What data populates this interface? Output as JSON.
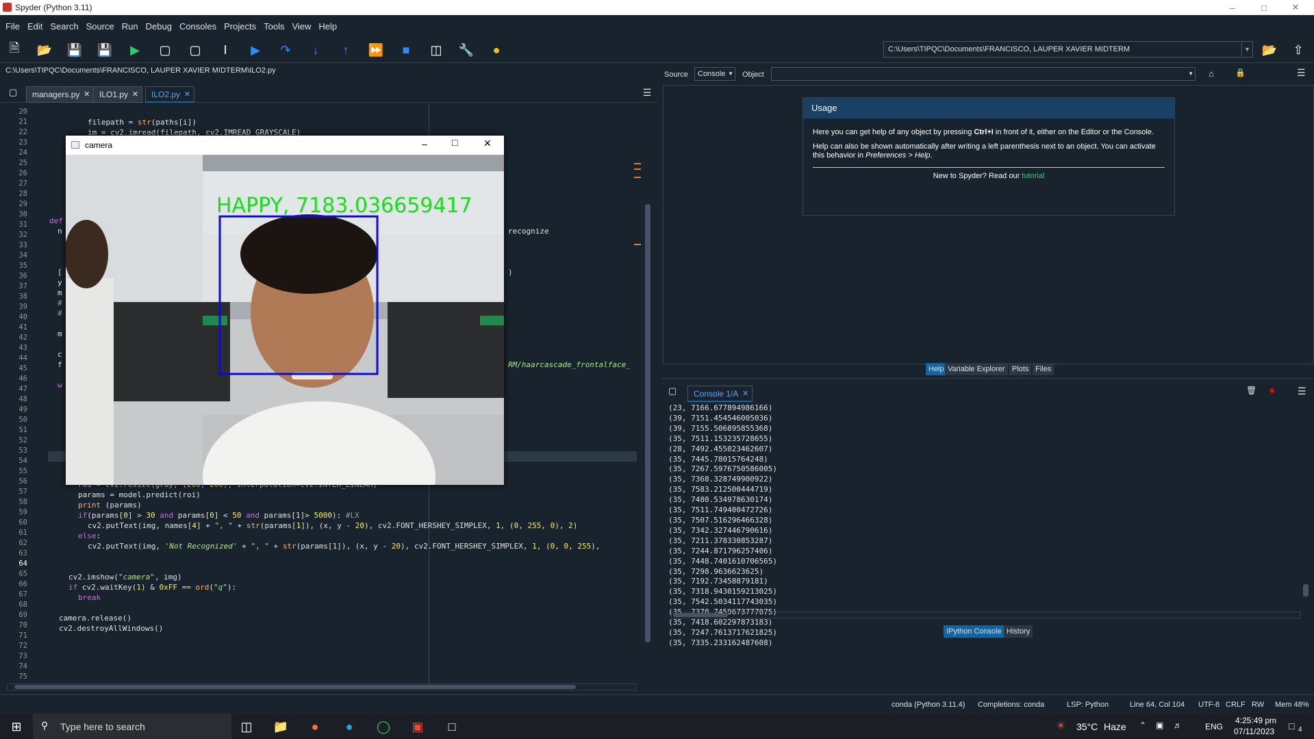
{
  "window": {
    "title": "Spyder (Python 3.11)",
    "minimize": "–",
    "maximize": "□",
    "close": "✕"
  },
  "menu": [
    "File",
    "Edit",
    "Search",
    "Source",
    "Run",
    "Debug",
    "Consoles",
    "Projects",
    "Tools",
    "View",
    "Help"
  ],
  "toolbar": {
    "working_dir": "C:\\Users\\TIPQC\\Documents\\FRANCISCO, LAUPER XAVIER MIDTERM"
  },
  "editor": {
    "file_path": "C:\\Users\\TIPQC\\Documents\\FRANCISCO, LAUPER XAVIER MIDTERM\\ILO2.py",
    "tabs": [
      {
        "label": "managers.py"
      },
      {
        "label": "ILO1.py"
      },
      {
        "label": "ILO2.py"
      }
    ],
    "active_line": "64",
    "line_numbers": [
      "20",
      "21",
      "22",
      "23",
      "24",
      "25",
      "26",
      "27",
      "28",
      "29",
      "30",
      "31",
      "32",
      "33",
      "34",
      "35",
      "36",
      "37",
      "38",
      "39",
      "40",
      "41",
      "42",
      "43",
      "44",
      "45",
      "46",
      "47",
      "48",
      "49",
      "50",
      "51",
      "52",
      "53",
      "54",
      "55",
      "56",
      "57",
      "58",
      "59",
      "60",
      "61",
      "62",
      "63",
      "64",
      "65",
      "66",
      "67",
      "68",
      "69",
      "70",
      "71",
      "72",
      "73",
      "74",
      "75"
    ],
    "partial_left": {
      "l33": "def",
      "l34": "n",
      "l39": "[",
      "l40": "y",
      "l41": "m",
      "l42": "#",
      "l43": "#",
      "l45": "m",
      "l47": "c",
      "l48": "f",
      "l50": "w"
    },
    "partial_right": {
      "l34": "recognize",
      "l39": ")",
      "l48": "RM/haarcascade_frontalface_"
    }
  },
  "camera_window": {
    "title": "camera",
    "overlay_text": "HAPPY, 7183.036659417"
  },
  "help_pane": {
    "source_label": "Source",
    "source_value": "Console",
    "object_label": "Object",
    "usage_title": "Usage",
    "usage_p1a": "Here you can get help of any object by pressing ",
    "usage_p1b": "Ctrl+I",
    "usage_p1c": " in front of it, either on the Editor or the Console.",
    "usage_p2a": "Help can also be shown automatically after writing a left parenthesis next to an object. You can activate this behavior in ",
    "usage_p2b": "Preferences > Help",
    "usage_p2c": ".",
    "usage_p3a": "New to Spyder? Read our ",
    "usage_p3b": "tutorial",
    "tabs": [
      "Help",
      "Variable Explorer",
      "Plots",
      "Files"
    ]
  },
  "console": {
    "tab": "Console 1/A",
    "lines": [
      "(23, 7166.677894986166)",
      "(39, 7151.454546005036)",
      "(39, 7155.506895855368)",
      "(35, 7511.153235728655)",
      "(28, 7492.455023462607)",
      "(35, 7445.78015764248)",
      "(35, 7267.5976750586005)",
      "(35, 7368.328749900922)",
      "(35, 7583.212500444719)",
      "(35, 7480.534978630174)",
      "(35, 7511.749400472726)",
      "(35, 7507.516296466328)",
      "(35, 7342.327446790616)",
      "(35, 7211.378330853287)",
      "(35, 7244.871796257406)",
      "(35, 7448.7401610706565)",
      "(35, 7298.9636623625)",
      "(35, 7192.73458879181)",
      "(35, 7318.9430159213025)",
      "(35, 7542.5034117743035)",
      "(35, 7370.7459673777075)",
      "(35, 7418.602297873183)",
      "(35, 7247.7613717621825)",
      "(35, 7335.233162487608)"
    ],
    "bottom_tabs": [
      "IPython Console",
      "History"
    ]
  },
  "status": {
    "env": "conda (Python 3.11.4)",
    "completions": "Completions: conda",
    "lsp": "LSP: Python",
    "position": "Line 64, Col 104",
    "encoding": "UTF-8",
    "eol": "CRLF",
    "perm": "RW",
    "mem": "Mem 48%"
  },
  "taskbar": {
    "search_placeholder": "Type here to search",
    "weather_temp": "35°C",
    "weather_desc": "Haze",
    "lang": "ENG",
    "time": "4:25:49 pm",
    "date": "07/11/2023",
    "notif_count": "4"
  }
}
